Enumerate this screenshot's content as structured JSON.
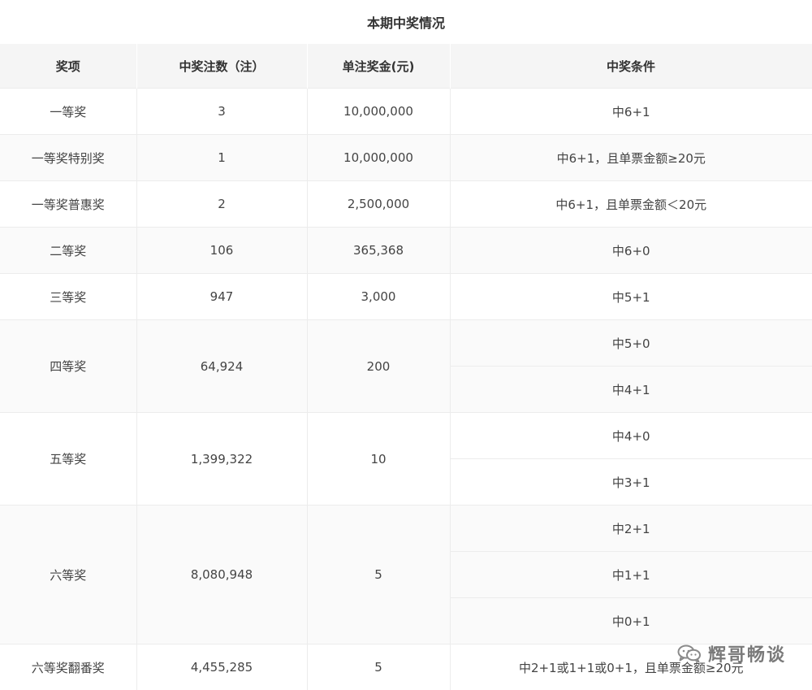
{
  "title": "本期中奖情况",
  "headers": [
    "奖项",
    "中奖注数（注）",
    "单注奖金(元)",
    "中奖条件"
  ],
  "rows": [
    {
      "prize": "一等奖",
      "count": "3",
      "amount": "10,000,000",
      "conditions": [
        "中6+1"
      ]
    },
    {
      "prize": "一等奖特别奖",
      "count": "1",
      "amount": "10,000,000",
      "conditions": [
        "中6+1，且单票金额≥20元"
      ]
    },
    {
      "prize": "一等奖普惠奖",
      "count": "2",
      "amount": "2,500,000",
      "conditions": [
        "中6+1，且单票金额＜20元"
      ]
    },
    {
      "prize": "二等奖",
      "count": "106",
      "amount": "365,368",
      "conditions": [
        "中6+0"
      ]
    },
    {
      "prize": "三等奖",
      "count": "947",
      "amount": "3,000",
      "conditions": [
        "中5+1"
      ]
    },
    {
      "prize": "四等奖",
      "count": "64,924",
      "amount": "200",
      "conditions": [
        "中5+0",
        "中4+1"
      ]
    },
    {
      "prize": "五等奖",
      "count": "1,399,322",
      "amount": "10",
      "conditions": [
        "中4+0",
        "中3+1"
      ]
    },
    {
      "prize": "六等奖",
      "count": "8,080,948",
      "amount": "5",
      "conditions": [
        "中2+1",
        "中1+1",
        "中0+1"
      ]
    },
    {
      "prize": "六等奖翻番奖",
      "count": "4,455,285",
      "amount": "5",
      "conditions": [
        "中2+1或1+1或0+1，且单票金额≥20元"
      ]
    }
  ],
  "watermark": {
    "text": "辉哥畅谈",
    "icon": "wechat-icon"
  }
}
